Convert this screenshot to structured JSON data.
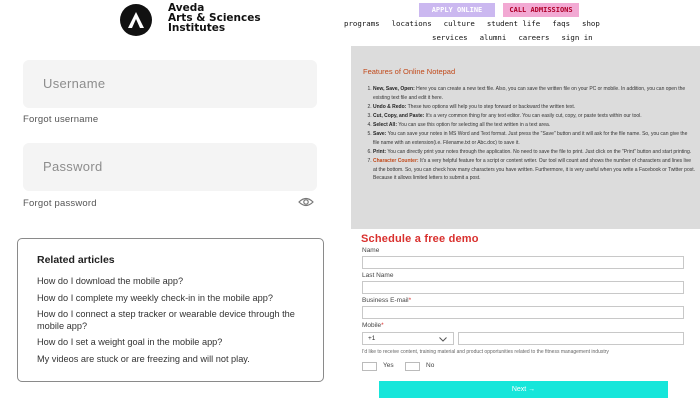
{
  "header": {
    "logo_lines": [
      "Aveda",
      "Arts & Sciences",
      "Institutes"
    ],
    "apply_label": "APPLY ONLINE",
    "admissions_label": "CALL ADMISSIONS",
    "nav_row1": [
      "programs",
      "locations",
      "culture",
      "student life",
      "faqs",
      "shop"
    ],
    "nav_row2": [
      "services",
      "alumni",
      "careers",
      "sign in"
    ]
  },
  "login": {
    "username_placeholder": "Username",
    "forgot_username": "Forgot username",
    "password_placeholder": "Password",
    "forgot_password": "Forgot password"
  },
  "related": {
    "title": "Related articles",
    "items": [
      "How do I download the mobile app?",
      "How do I complete my weekly check-in in the mobile app?",
      "How do I connect a step tracker or wearable device through the mobile app?",
      "How do I set a weight goal in the mobile app?",
      "My videos are stuck or are freezing and will not play."
    ]
  },
  "notepad": {
    "title": "Features of Online Notepad",
    "items": [
      {
        "term": "New, Save, Open:",
        "text": " Here you can create a new text file. Also, you can save the written file on your PC or mobile. In addition, you can open the existing text file and edit it here."
      },
      {
        "term": "Undo & Redo:",
        "text": " These two options will help you to step forward or backward the written text."
      },
      {
        "term": "Cut, Copy, and Paste:",
        "text": " It's a very common thing for any text editor. You can easily cut, copy, or paste texts within our tool."
      },
      {
        "term": "Select All:",
        "text": " You can use this option for selecting all the text written in a text area."
      },
      {
        "term": "Save:",
        "text": " You can save your notes in MS Word and Text format. Just press the \"Save\" button and it will ask for the file name. So, you can give the file name with an extension(i.e. Filename.txt or Abc.doc) to save it."
      },
      {
        "term": "Print:",
        "text": " You can directly print your notes through the application. No need to save the file to print. Just click on the \"Print\" button and start printing."
      },
      {
        "term": "Character Counter:",
        "text": " It's a very helpful feature for a script or content writer. Our tool will count and shows the number of characters and lines live at the bottom. So, you can check how many characters you have written. Furthermore, it is very useful when you write a Facebook or Twitter post. Because it allows limited letters to submit a post."
      }
    ]
  },
  "demo_form": {
    "title": "Schedule a free demo",
    "name_label": "Name",
    "last_name_label": "Last Name",
    "email_label": "Business E-mail",
    "mobile_label": "Mobile",
    "country_code": "+1",
    "consent_text": "I'd like to receive content, training material and product opportunities related to the fitness management industry",
    "yes_label": "Yes",
    "no_label": "No",
    "next_label": "Next →",
    "required_mark": "*"
  }
}
